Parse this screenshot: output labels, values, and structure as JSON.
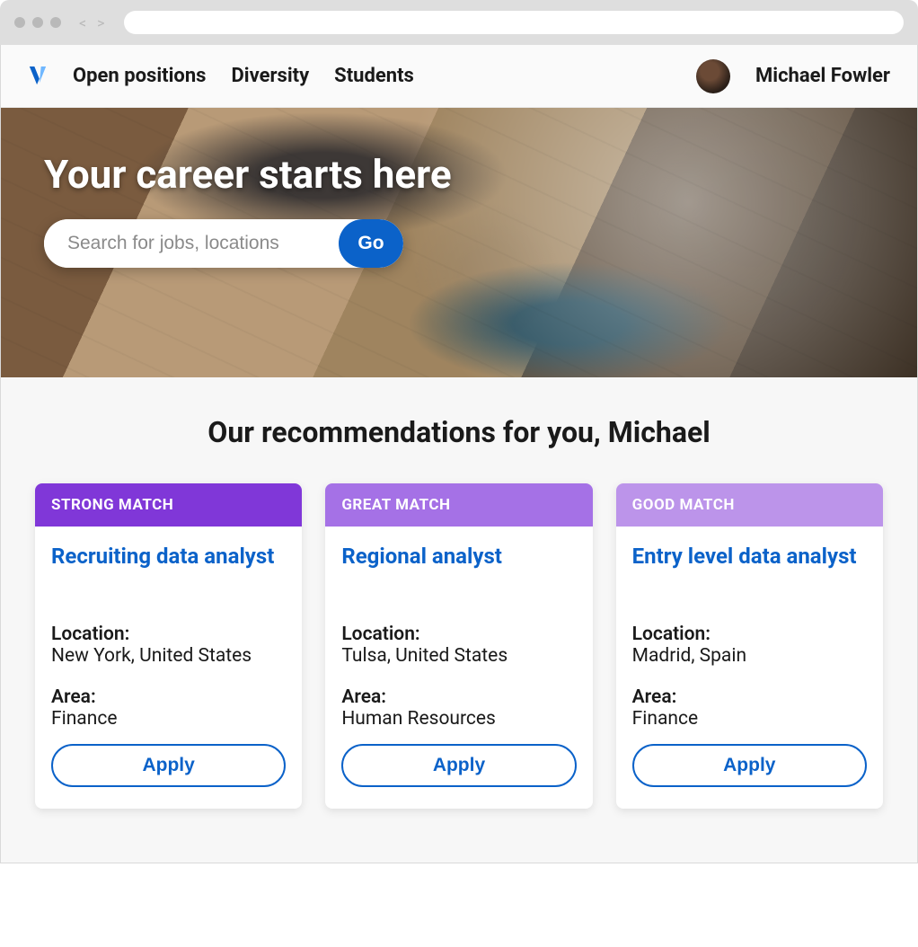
{
  "nav": {
    "links": [
      "Open positions",
      "Diversity",
      "Students"
    ],
    "user_name": "Michael Fowler"
  },
  "hero": {
    "title": "Your career starts here",
    "search_placeholder": "Search for jobs, locations",
    "go_label": "Go"
  },
  "section": {
    "title": "Our recommendations for you, Michael",
    "location_label": "Location:",
    "area_label": "Area:",
    "apply_label": "Apply"
  },
  "colors": {
    "badge": [
      "#8037d8",
      "#a571e6",
      "#bc94ea"
    ]
  },
  "cards": [
    {
      "badge": "STRONG MATCH",
      "title": "Recruiting data analyst",
      "location": "New York, United States",
      "area": "Finance"
    },
    {
      "badge": "GREAT MATCH",
      "title": "Regional analyst",
      "location": "Tulsa, United States",
      "area": "Human Resources"
    },
    {
      "badge": "GOOD MATCH",
      "title": "Entry level data analyst",
      "location": "Madrid, Spain",
      "area": "Finance"
    }
  ]
}
